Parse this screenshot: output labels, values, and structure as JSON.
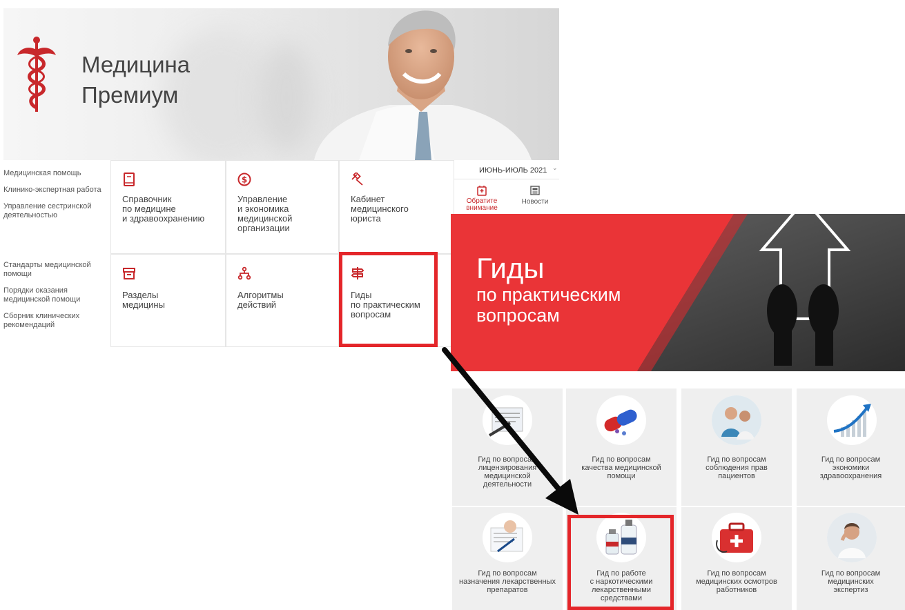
{
  "brand": {
    "line1": "Медицина",
    "line2": "Премиум"
  },
  "left_menu_top": [
    "Медицинская помощь",
    "Клинико-экспертная работа",
    "Управление сестринской деятельностью"
  ],
  "left_menu_bottom": [
    "Стандарты медицинской помощи",
    "Порядки оказания медицинской помощи",
    "Сборник клинических рекомендаций"
  ],
  "tiles": {
    "spravochnik": [
      "Справочник",
      "по медицине",
      "и здравоохранению"
    ],
    "upravlenie": [
      "Управление",
      "и экономика",
      "медицинской",
      "организации"
    ],
    "kabinet": [
      "Кабинет",
      "медицинского",
      "юриста"
    ],
    "razdely": [
      "Разделы",
      "медицины"
    ],
    "algoritmy": [
      "Алгоритмы",
      "действий"
    ],
    "gidy": [
      "Гиды",
      "по практическим",
      "вопросам"
    ]
  },
  "issue": {
    "label": "ИЮНЬ-ИЮЛЬ 2021"
  },
  "attention": {
    "line1": "Обратите",
    "line2": "внимание"
  },
  "news": {
    "label": "Новости"
  },
  "banner": {
    "title": "Гиды",
    "line2": "по практическим",
    "line3": "вопросам"
  },
  "guides": [
    [
      "Гид по вопросам",
      "лицензирования",
      "медицинской",
      "деятельности"
    ],
    [
      "Гид по вопросам",
      "качества медицинской",
      "помощи"
    ],
    [
      "Гид по вопросам",
      "соблюдения прав",
      "пациентов"
    ],
    [
      "Гид по вопросам",
      "экономики",
      "здравоохранения"
    ],
    [
      "Гид по вопросам",
      "назначения лекарственных",
      "препаратов"
    ],
    [
      "Гид по работе",
      "с наркотическими",
      "лекарственными",
      "средствами"
    ],
    [
      "Гид по вопросам",
      "медицинских осмотров",
      "работников"
    ],
    [
      "Гид по вопросам",
      "медицинских",
      "экспертиз"
    ]
  ],
  "colors": {
    "accent": "#c8282b",
    "highlight": "#e4262a",
    "banner_red": "#ea3437",
    "tile_bg": "#efefef"
  }
}
